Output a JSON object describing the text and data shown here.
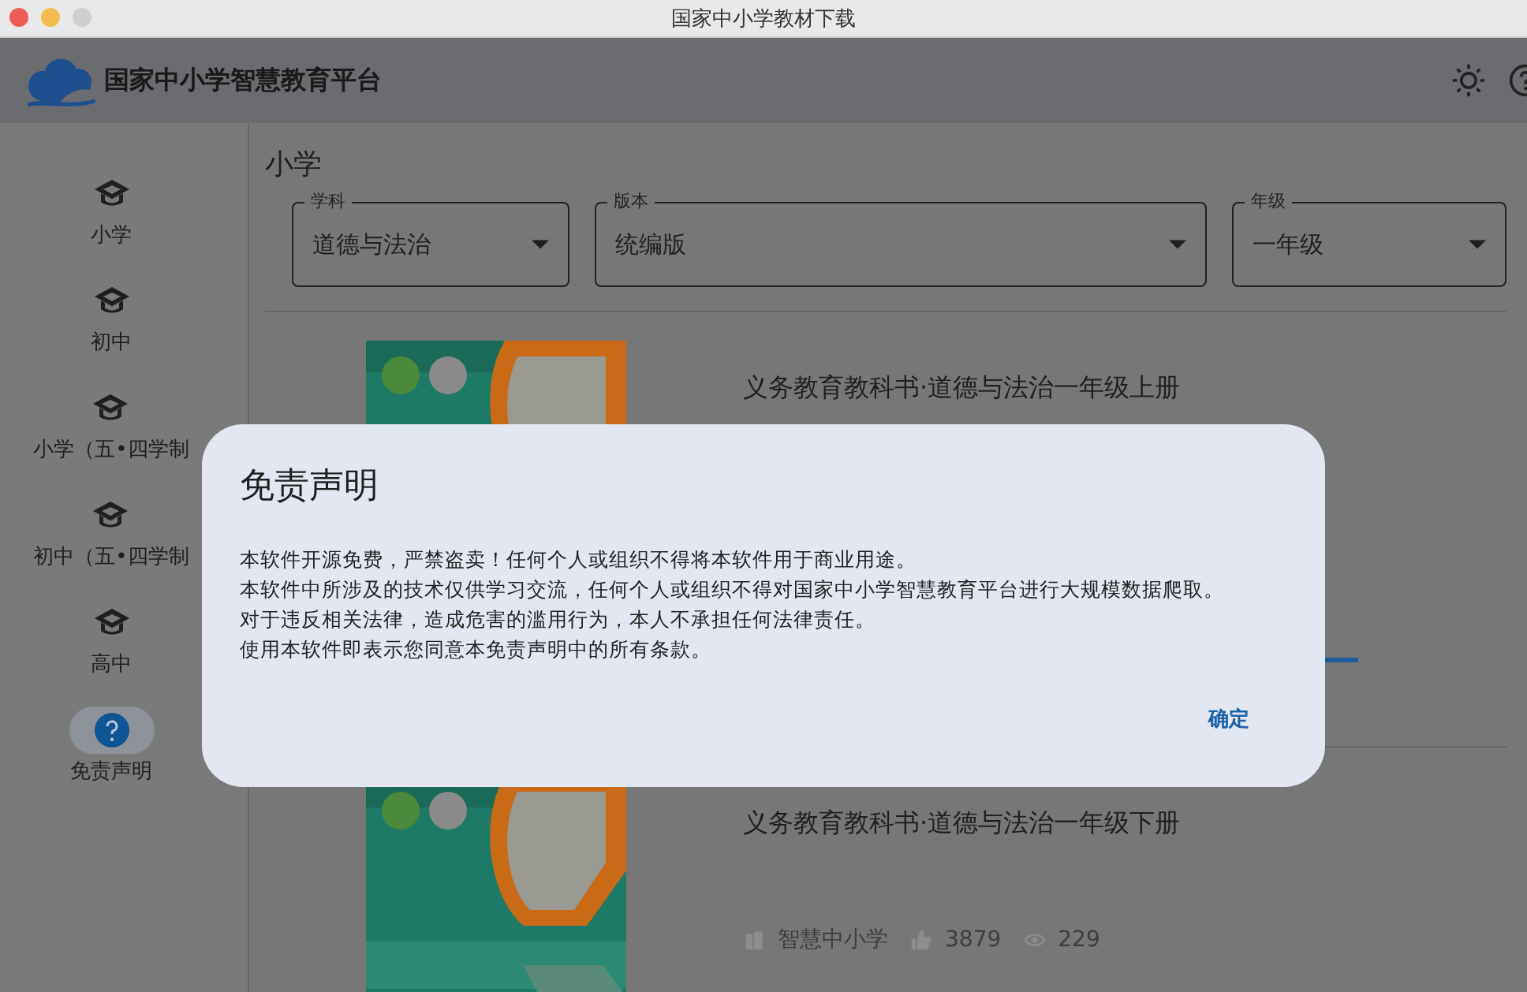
{
  "window": {
    "title": "国家中小学教材下载"
  },
  "header": {
    "brand": "国家中小学智慧教育平台"
  },
  "sidebar": {
    "items": [
      {
        "label": "小学",
        "kind": "level",
        "selected": false
      },
      {
        "label": "初中",
        "kind": "level",
        "selected": false
      },
      {
        "label": "小学（五•四学制",
        "kind": "level",
        "selected": false
      },
      {
        "label": "初中（五•四学制",
        "kind": "level",
        "selected": false
      },
      {
        "label": "高中",
        "kind": "level",
        "selected": false
      },
      {
        "label": "免责声明",
        "kind": "help",
        "selected": true
      }
    ]
  },
  "content": {
    "heading": "小学",
    "filters": [
      {
        "label": "学科",
        "value": "道德与法治"
      },
      {
        "label": "版本",
        "value": "统编版"
      },
      {
        "label": "年级",
        "value": "一年级"
      }
    ],
    "books": [
      {
        "title": "义务教育教科书·道德与法治一年级上册"
      },
      {
        "title": "义务教育教科书·道德与法治一年级下册",
        "publisher": "智慧中小学",
        "likes": "3879",
        "views": "229"
      }
    ]
  },
  "dialog": {
    "title": "免责声明",
    "lines": [
      "本软件开源免费，严禁盗卖！任何个人或组织不得将本软件用于商业用途。",
      "本软件中所涉及的技术仅供学习交流，任何个人或组织不得对国家中小学智慧教育平台进行大规模数据爬取。",
      "对于违反相关法律，造成危害的滥用行为，本人不承担任何法律责任。",
      "使用本软件即表示您同意本免责声明中的所有条款。"
    ],
    "button": "确定"
  }
}
